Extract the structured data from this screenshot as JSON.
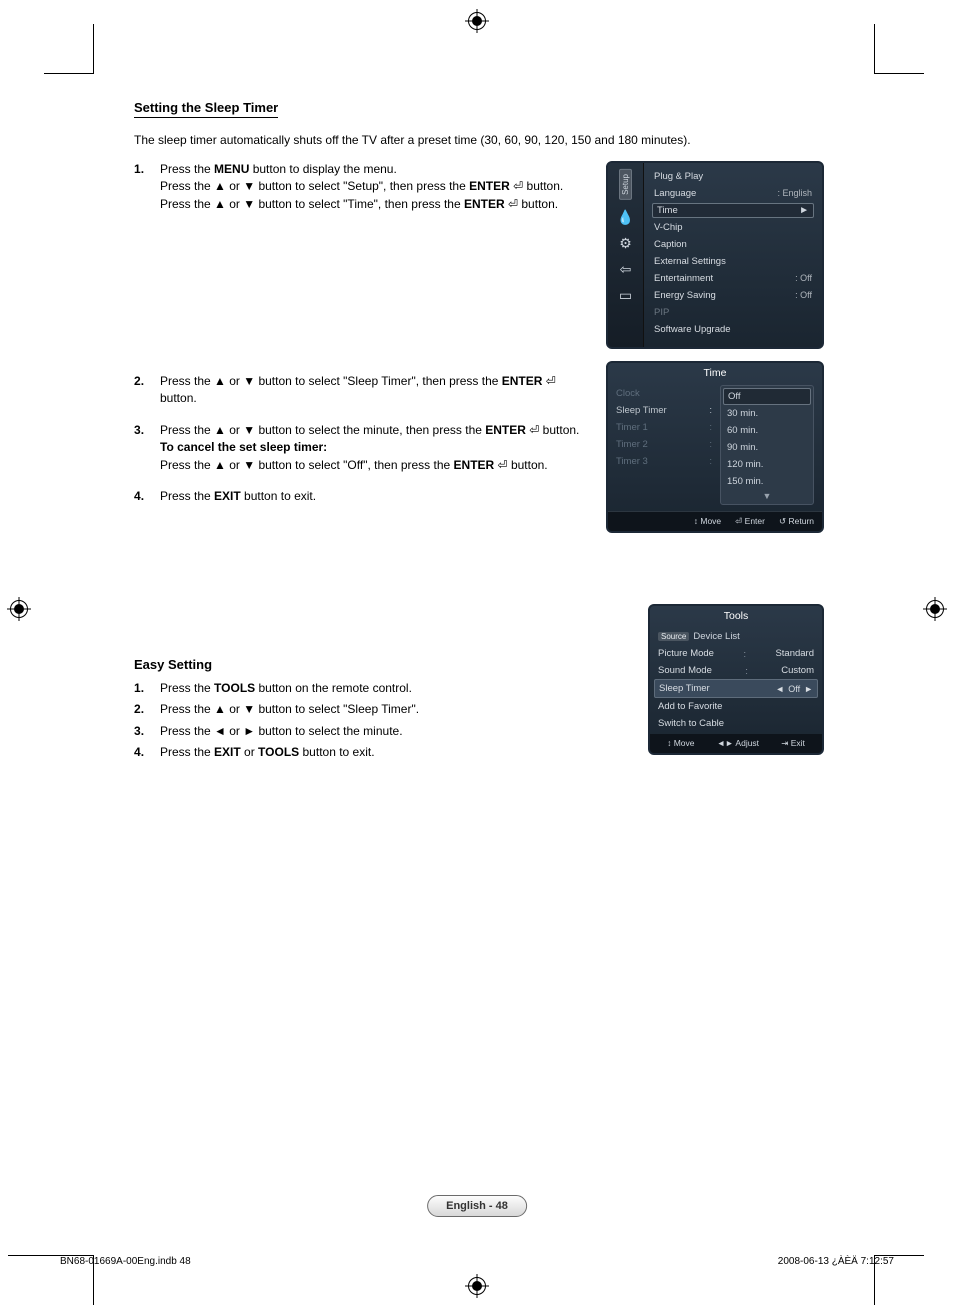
{
  "section_title": "Setting the Sleep Timer",
  "intro": "The sleep timer automatically shuts off the TV after a preset time (30, 60, 90, 120, 150 and 180 minutes).",
  "steps": [
    {
      "num": "1.",
      "parts": [
        [
          {
            "t": "Press the "
          },
          {
            "t": "MENU",
            "b": true
          },
          {
            "t": " button to display the menu."
          }
        ],
        [
          {
            "t": "Press the ▲ or ▼ button to select \"Setup\", then press the "
          },
          {
            "t": "ENTER",
            "b": true
          },
          {
            "t": " ",
            "enter": true
          },
          {
            "t": " button."
          }
        ],
        [
          {
            "t": "Press the ▲ or ▼ button to select \"Time\", then press the "
          },
          {
            "t": "ENTER",
            "b": true
          },
          {
            "t": " ",
            "enter": true
          },
          {
            "t": " button."
          }
        ]
      ]
    },
    {
      "num": "2.",
      "parts": [
        [
          {
            "t": "Press the ▲ or ▼ button to select \"Sleep Timer\", then press the "
          },
          {
            "t": "ENTER",
            "b": true
          },
          {
            "t": " ",
            "enter": true
          },
          {
            "t": " button."
          }
        ]
      ]
    },
    {
      "num": "3.",
      "parts": [
        [
          {
            "t": "Press the ▲ or ▼ button to select the minute, then press the "
          },
          {
            "t": "ENTER",
            "b": true
          },
          {
            "t": " ",
            "enter": true
          },
          {
            "t": " button."
          }
        ],
        [
          {
            "t": "To cancel the set sleep timer:",
            "b": true
          }
        ],
        [
          {
            "t": "Press the ▲ or ▼ button to select \"Off\", then press the "
          },
          {
            "t": "ENTER",
            "b": true
          },
          {
            "t": " ",
            "enter": true
          },
          {
            "t": " button."
          }
        ]
      ]
    },
    {
      "num": "4.",
      "parts": [
        [
          {
            "t": "Press the "
          },
          {
            "t": "EXIT",
            "b": true
          },
          {
            "t": " button to exit."
          }
        ]
      ]
    }
  ],
  "easy_title": "Easy Setting",
  "easy_steps": [
    [
      {
        "t": "Press the "
      },
      {
        "t": "TOOLS",
        "b": true
      },
      {
        "t": " button on the remote control."
      }
    ],
    [
      {
        "t": "Press the ▲ or ▼ button to select \"Sleep Timer\"."
      }
    ],
    [
      {
        "t": "Press the ◄ or ► button to select the minute."
      }
    ],
    [
      {
        "t": "Press the "
      },
      {
        "t": "EXIT",
        "b": true
      },
      {
        "t": " or "
      },
      {
        "t": "TOOLS",
        "b": true
      },
      {
        "t": " button to exit."
      }
    ]
  ],
  "osd1": {
    "sidebar_label": "Setup",
    "items": [
      {
        "label": "Plug & Play",
        "val": ""
      },
      {
        "label": "Language",
        "val": ": English"
      },
      {
        "label": "Time",
        "val": "►",
        "selected": true
      },
      {
        "label": "V-Chip",
        "val": ""
      },
      {
        "label": "Caption",
        "val": ""
      },
      {
        "label": "External Settings",
        "val": ""
      },
      {
        "label": "Entertainment",
        "val": ": Off"
      },
      {
        "label": "Energy Saving",
        "val": ": Off"
      },
      {
        "label": "PIP",
        "val": "",
        "dim": true
      },
      {
        "label": "Software Upgrade",
        "val": ""
      }
    ]
  },
  "osd2": {
    "title": "Time",
    "left": [
      {
        "label": "Clock",
        "suffix": "",
        "dim": true
      },
      {
        "label": "Sleep Timer",
        "suffix": ":",
        "active": true
      },
      {
        "label": "Timer 1",
        "suffix": ":",
        "dim": true
      },
      {
        "label": "Timer 2",
        "suffix": ":",
        "dim": true
      },
      {
        "label": "Timer 3",
        "suffix": ":",
        "dim": true
      }
    ],
    "options": [
      "Off",
      "30 min.",
      "60 min.",
      "90 min.",
      "120 min.",
      "150 min."
    ],
    "selected": "Off",
    "foot": {
      "move": "Move",
      "enter": "Enter",
      "return": "Return"
    }
  },
  "tools": {
    "title": "Tools",
    "rows": [
      {
        "type": "device",
        "src": "Source",
        "label": "Device List"
      },
      {
        "type": "kv",
        "label": "Picture Mode",
        "mid": ":",
        "val": "Standard"
      },
      {
        "type": "kv",
        "label": "Sound Mode",
        "mid": ":",
        "val": "Custom"
      },
      {
        "type": "sel",
        "label": "Sleep Timer",
        "val": "Off"
      },
      {
        "type": "plain",
        "label": "Add to Favorite"
      },
      {
        "type": "plain",
        "label": "Switch to Cable"
      }
    ],
    "foot": {
      "move": "Move",
      "adjust": "Adjust",
      "exit": "Exit"
    }
  },
  "page_badge": "English - 48",
  "footer_left": "BN68-01669A-00Eng.indb   48",
  "footer_right": "2008-06-13   ¿ÀÈÄ 7:12:57",
  "glyphs": {
    "enter": "⏎",
    "updown": "↕",
    "leftright": "◄►",
    "return": "↺",
    "exit": "⇥"
  }
}
